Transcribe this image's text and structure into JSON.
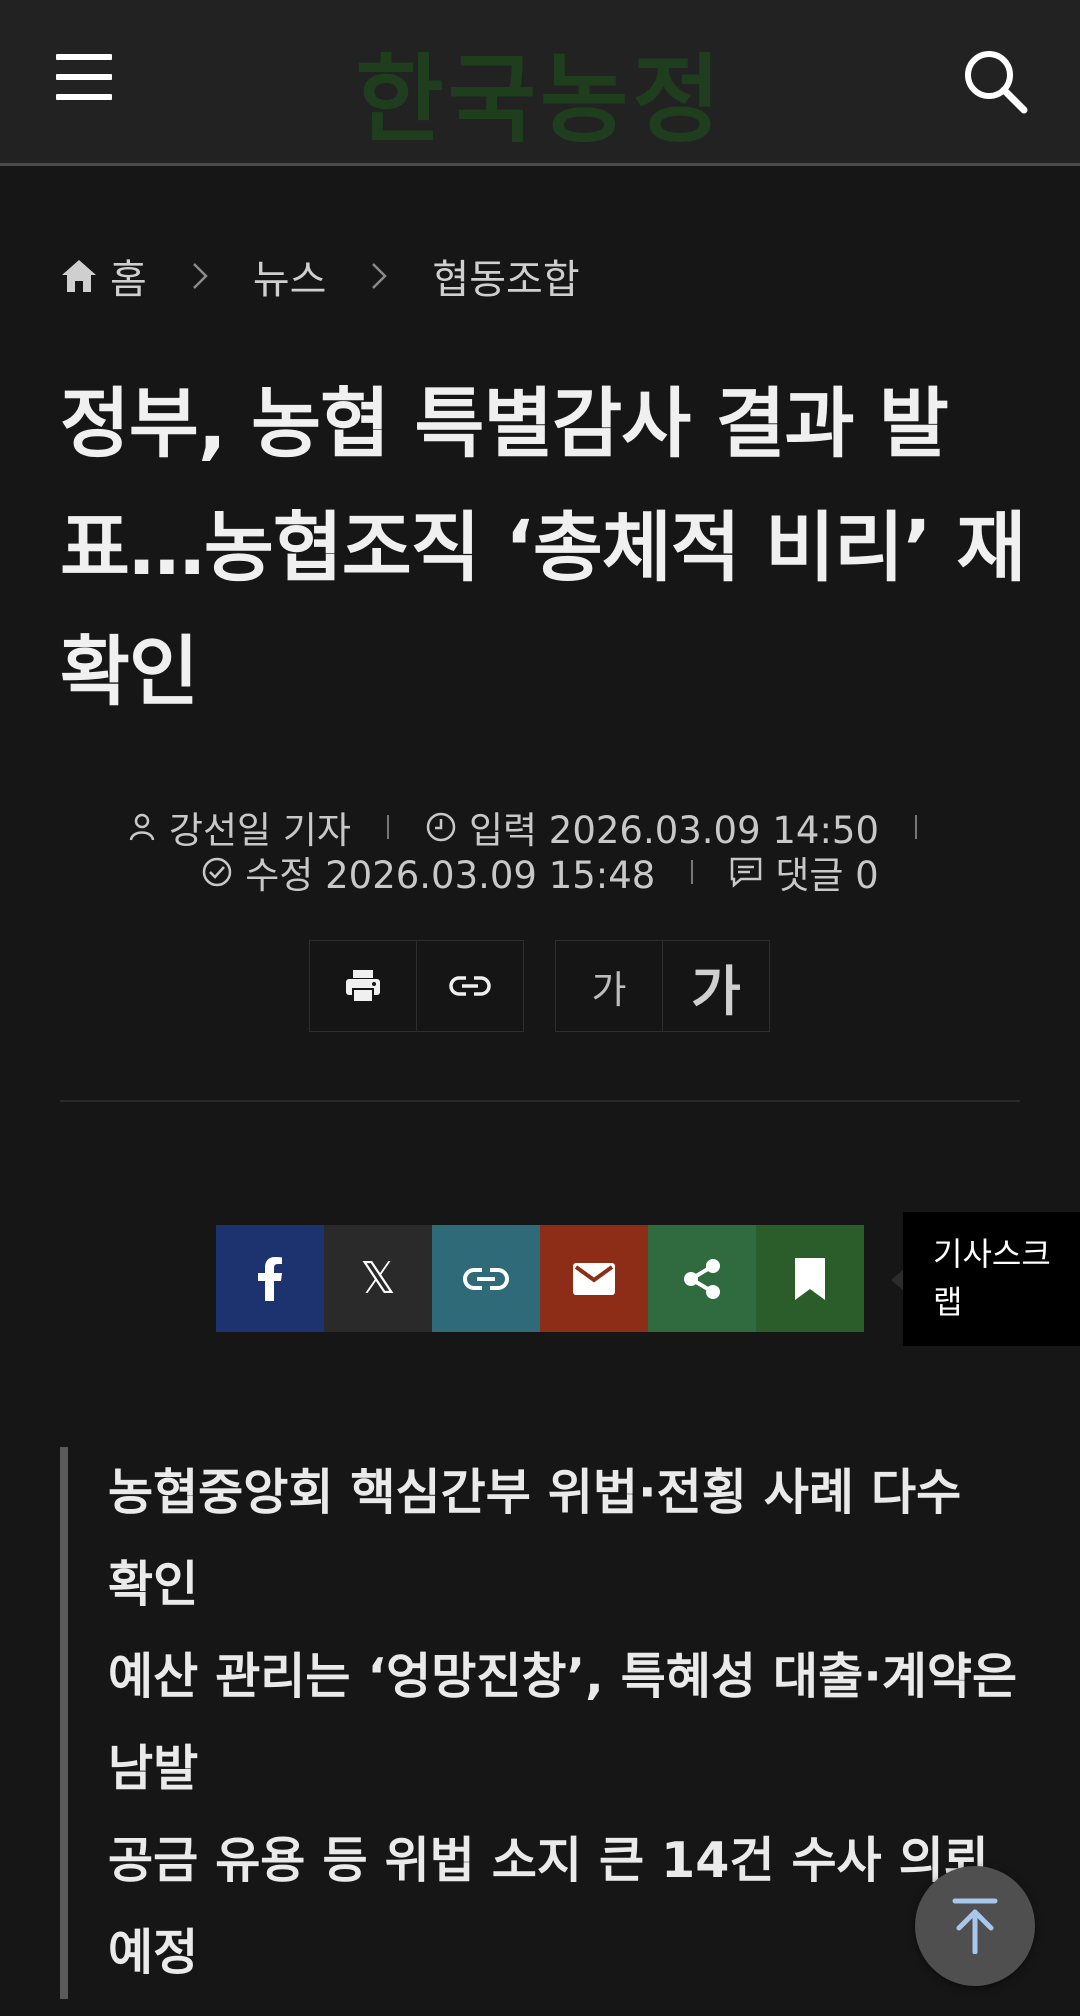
{
  "header": {
    "logo": "한국농정"
  },
  "breadcrumb": {
    "home": "홈",
    "news": "뉴스",
    "section": "협동조합"
  },
  "article": {
    "title": "정부, 농협 특별감사 결과 발표…농협조직 ‘총체적 비리’ 재확인",
    "author": "강선일 기자",
    "published": "입력 2026.03.09 14:50",
    "modified": "수정 2026.03.09 15:48",
    "comments": "댓글 0",
    "summary": [
      "농협중앙회 핵심간부 위법·전횡 사례 다수 확인",
      "예산 관리는 ‘엉망진창’, 특혜성 대출·계약은 남발",
      "공금 유용 등 위법 소지 큰 14건 수사 의뢰 예정"
    ]
  },
  "tools": {
    "font_small": "가",
    "font_large": "가"
  },
  "share": {
    "x_glyph": "𝕏",
    "scrap_label": "기사스크랩"
  },
  "colors": {
    "facebook": "#1d3370",
    "x": "#2a2a2a",
    "link": "#2e6a78",
    "email": "#8e2d17",
    "share": "#2f6b3e",
    "bookmark": "#2a5d2a"
  }
}
